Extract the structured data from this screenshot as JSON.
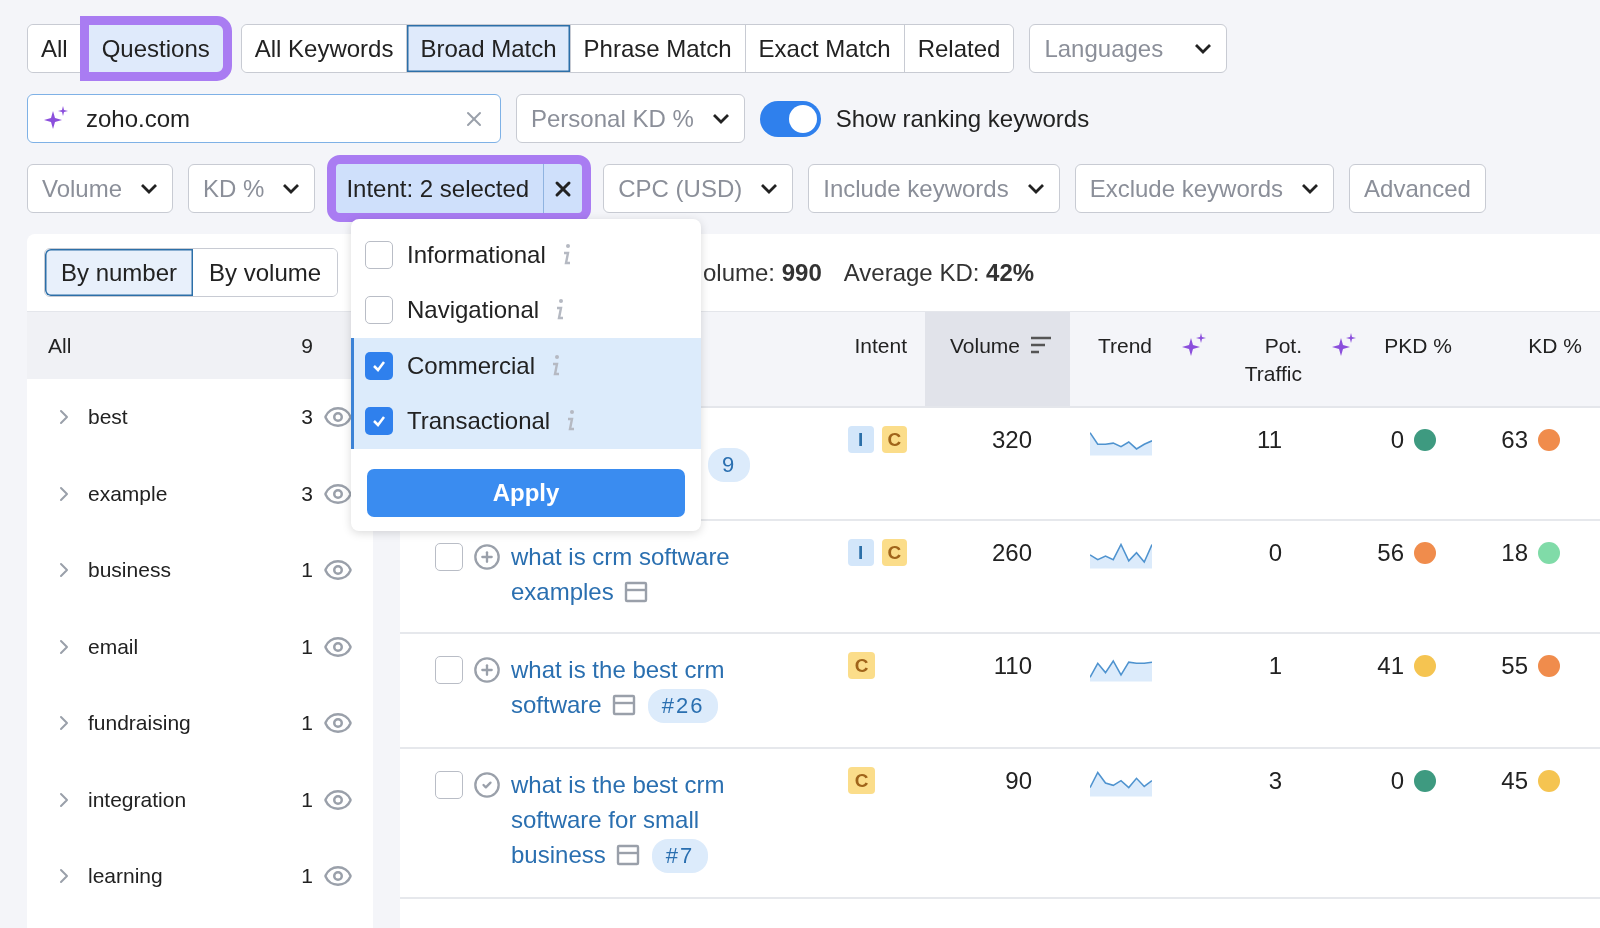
{
  "search_type_tabs": [
    {
      "label": "All",
      "selected": false,
      "highlighted": false
    },
    {
      "label": "Questions",
      "selected": true,
      "highlighted": true
    }
  ],
  "match_tabs": [
    {
      "label": "All Keywords",
      "selected": false
    },
    {
      "label": "Broad Match",
      "selected": true
    },
    {
      "label": "Phrase Match",
      "selected": false
    },
    {
      "label": "Exact Match",
      "selected": false
    },
    {
      "label": "Related",
      "selected": false
    }
  ],
  "languages": {
    "placeholder": "Languages"
  },
  "domain_field": {
    "value": "zoho.com"
  },
  "personal_kd": {
    "placeholder": "Personal KD %"
  },
  "ranking_toggle": {
    "label": "Show ranking keywords",
    "on": true
  },
  "filters": [
    {
      "kind": "dropdown",
      "label": "Volume"
    },
    {
      "kind": "dropdown",
      "label": "KD %"
    },
    {
      "kind": "active",
      "label": "Intent: 2 selected",
      "highlighted": true
    },
    {
      "kind": "dropdown",
      "label": "CPC (USD)"
    },
    {
      "kind": "dropdown",
      "label": "Include keywords"
    },
    {
      "kind": "dropdown",
      "label": "Exclude keywords"
    },
    {
      "kind": "plain",
      "label": "Advanced"
    }
  ],
  "intent_menu": {
    "options": [
      {
        "label": "Informational",
        "checked": false
      },
      {
        "label": "Navigational",
        "checked": false
      },
      {
        "label": "Commercial",
        "checked": true
      },
      {
        "label": "Transactional",
        "checked": true
      }
    ],
    "apply": "Apply"
  },
  "group_toggle": [
    {
      "label": "By number",
      "selected": true
    },
    {
      "label": "By volume",
      "selected": false
    }
  ],
  "groups_all": {
    "label": "All",
    "count": "9"
  },
  "groups": [
    {
      "label": "best",
      "count": "3"
    },
    {
      "label": "example",
      "count": "3"
    },
    {
      "label": "business",
      "count": "1"
    },
    {
      "label": "email",
      "count": "1"
    },
    {
      "label": "fundraising",
      "count": "1"
    },
    {
      "label": "integration",
      "count": "1"
    },
    {
      "label": "learning",
      "count": "1"
    }
  ],
  "summary": [
    "olume: **990**",
    "Average KD: **42%**"
  ],
  "table": {
    "columns": [
      {
        "label": "Intent",
        "sorted": false,
        "ai": false
      },
      {
        "label": "Volume",
        "sorted": true,
        "ai": false
      },
      {
        "label": "Trend",
        "sorted": false,
        "ai": false
      },
      {
        "label": "Pot. Traffic",
        "sorted": false,
        "ai": true
      },
      {
        "label": "PKD %",
        "sorted": false,
        "ai": true
      },
      {
        "label": "KD %",
        "sorted": false,
        "ai": false
      }
    ],
    "rows": [
      {
        "rank": "9",
        "intents": [
          {
            "letter": "I",
            "kind": "informational"
          },
          {
            "letter": "C",
            "kind": "commercial"
          }
        ],
        "volume": "320",
        "pot_traffic": "11",
        "pkd": {
          "value": "0",
          "color": "#3e9a80"
        },
        "kd": {
          "value": "63",
          "color": "#f08c4c"
        }
      },
      {
        "checked": false,
        "added": false,
        "keyword": "what is crm software examples",
        "intents": [
          {
            "letter": "I",
            "kind": "informational"
          },
          {
            "letter": "C",
            "kind": "commercial"
          }
        ],
        "volume": "260",
        "pot_traffic": "0",
        "pkd": {
          "value": "56",
          "color": "#f08c4c"
        },
        "kd": {
          "value": "18",
          "color": "#80dba8"
        }
      },
      {
        "checked": false,
        "added": false,
        "keyword": "what is the best crm software",
        "rank": "#26",
        "intents": [
          {
            "letter": "C",
            "kind": "commercial"
          }
        ],
        "volume": "110",
        "pot_traffic": "1",
        "pkd": {
          "value": "41",
          "color": "#f5c451"
        },
        "kd": {
          "value": "55",
          "color": "#f08c4c"
        }
      },
      {
        "checked": false,
        "added": true,
        "keyword": "what is the best crm software for small business",
        "rank": "#7",
        "intents": [
          {
            "letter": "C",
            "kind": "commercial"
          }
        ],
        "volume": "90",
        "pot_traffic": "3",
        "pkd": {
          "value": "0",
          "color": "#3e9a80"
        },
        "kd": {
          "value": "45",
          "color": "#f5c451"
        }
      }
    ]
  }
}
